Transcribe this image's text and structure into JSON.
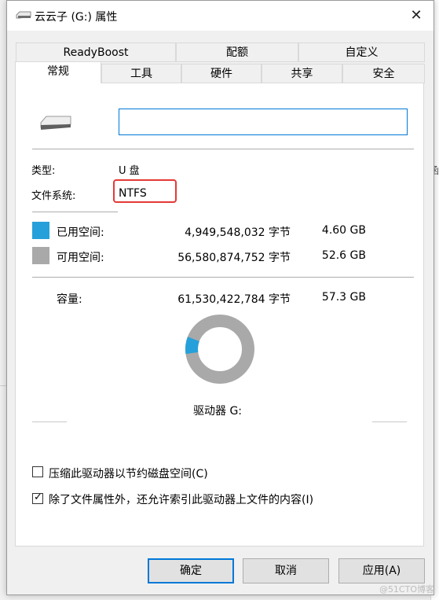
{
  "window": {
    "title": "云云子 (G:) 属性",
    "close_glyph": "✕"
  },
  "tabs": {
    "row1": [
      {
        "label": "ReadyBoost"
      },
      {
        "label": "配额"
      },
      {
        "label": "自定义"
      }
    ],
    "row2": [
      {
        "label": "常规",
        "active": true
      },
      {
        "label": "工具"
      },
      {
        "label": "硬件"
      },
      {
        "label": "共享"
      },
      {
        "label": "安全"
      }
    ]
  },
  "general": {
    "name_value": "",
    "type_label": "类型:",
    "type_value": "U 盘",
    "fs_label": "文件系统:",
    "fs_value": "NTFS",
    "used": {
      "label": "已用空间:",
      "bytes": "4,949,548,032 字节",
      "size": "4.60 GB",
      "color": "#26a0da"
    },
    "free": {
      "label": "可用空间:",
      "bytes": "56,580,874,752 字节",
      "size": "52.6 GB",
      "color": "#a9a9a9"
    },
    "capacity": {
      "label": "容量:",
      "bytes": "61,530,422,784 字节",
      "size": "57.3 GB"
    },
    "used_fraction": 0.0804,
    "drive_label": "驱动器 G:",
    "compress_label": "压缩此驱动器以节约磁盘空间(C)",
    "compress_checked": false,
    "index_label": "除了文件属性外，还允许索引此驱动器上文件的内容(I)",
    "index_checked": true
  },
  "buttons": {
    "ok": "确定",
    "cancel": "取消",
    "apply": "应用(A)"
  },
  "highlight_color": "#e53935",
  "watermark": "@51CTO博客",
  "bg_fragment": "函"
}
